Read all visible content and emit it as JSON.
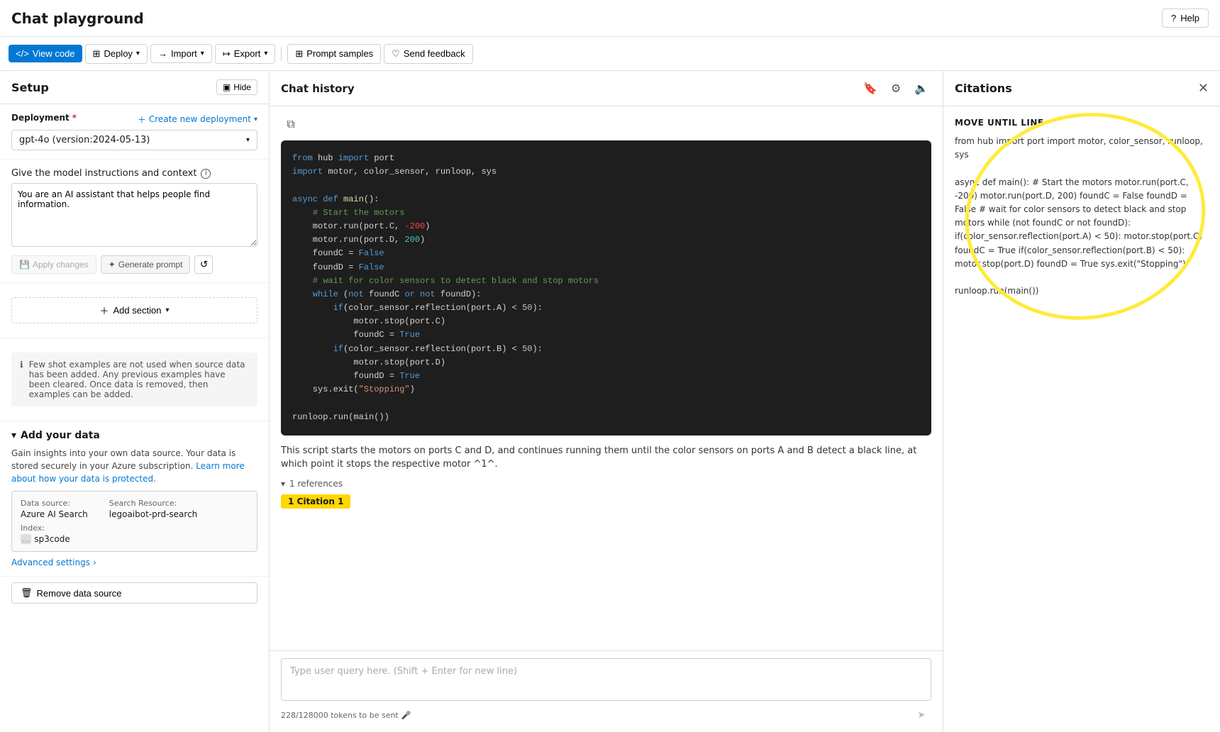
{
  "header": {
    "title": "Chat playground",
    "help_label": "Help"
  },
  "toolbar": {
    "view_code": "View code",
    "deploy": "Deploy",
    "import": "Import",
    "export": "Export",
    "prompt_samples": "Prompt samples",
    "send_feedback": "Send feedback"
  },
  "sidebar": {
    "title": "Setup",
    "hide_label": "Hide",
    "deployment": {
      "label": "Deployment",
      "create_new": "Create new deployment",
      "value": "gpt-4o (version:2024-05-13)"
    },
    "instructions": {
      "label": "Give the model instructions and context",
      "value": "You are an AI assistant that helps people find information."
    },
    "buttons": {
      "apply_changes": "Apply changes",
      "generate_prompt": "Generate prompt"
    },
    "add_section": "Add section",
    "info_message": "Few shot examples are not used when source data has been added. Any previous examples have been cleared. Once data is removed, then examples can be added.",
    "your_data": {
      "title": "Add your data",
      "description": "Gain insights into your own data source. Your data is stored securely in your Azure subscription.",
      "learn_more": "Learn more about how your data is protected.",
      "data_source_label": "Data source:",
      "data_source_value": "Azure AI Search",
      "search_resource_label": "Search Resource:",
      "search_resource_value": "legoaibot-prd-search",
      "index_label": "Index:",
      "index_value": "sp3code",
      "index_prefix": "...",
      "advanced_settings": "Advanced settings",
      "remove_btn": "Remove data source"
    }
  },
  "chat": {
    "title": "Chat history",
    "code_content": "from hub import port\nimport motor, color_sensor, runloop, sys\n\nasync def main():\n    # Start the motors\n    motor.run(port.C, -200)\n    motor.run(port.D, 200)\n    foundC = False\n    foundD = False\n    # wait for color sensors to detect black and stop motors\n    while (not foundC or not foundD):\n        if(color_sensor.reflection(port.A) < 50):\n            motor.stop(port.C)\n            foundC = True\n        if(color_sensor.reflection(port.B) < 50):\n            motor.stop(port.D)\n            foundD = True\n    sys.exit(\"Stopping\")\n\nrunloop.run(main())",
    "response_text": "This script starts the motors on ports C and D, and continues running them until the color sensors on ports A and B detect a black line, at which point it stops the respective motor ^1^.",
    "references": "1 references",
    "citation_label": "1  Citation 1",
    "input_placeholder": "Type user query here. (Shift + Enter for new line)",
    "token_count": "228/128000 tokens to be sent"
  },
  "citations": {
    "title": "Citations",
    "section_title": "MOVE UNTIL LINE",
    "content": "from hub import port import motor, color_sensor, runloop, sys\n\nasync def main(): # Start the motors motor.run(port.C, -200) motor.run(port.D, 200) foundC = False foundD = False # wait for color sensors to detect black and stop motors while (not foundC or not foundD): if(color_sensor.reflection(port.A) < 50): motor.stop(port.C) foundC = True if(color_sensor.reflection(port.B) < 50): motor.stop(port.D) foundD = True sys.exit(\"Stopping\")\n\nrunloop.run(main())"
  }
}
